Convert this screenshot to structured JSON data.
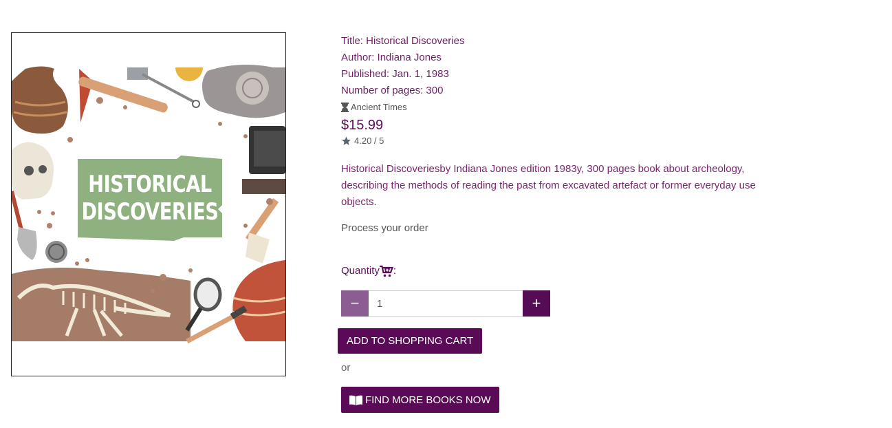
{
  "book": {
    "cover_title_line1": "HISTORICAL",
    "cover_title_line2": "DISCOVERIES",
    "title_line": "Title: Historical Discoveries",
    "author_line": "Author: Indiana Jones",
    "published_line": "Published: Jan. 1, 1983",
    "pages_line": "Number of pages: 300",
    "category": "Ancient Times",
    "category_icon": "hourglass-icon",
    "price": "$15.99",
    "rating_icon": "star-icon",
    "rating": "4.20 / 5",
    "description": "Historical Discoveriesby Indiana Jones edition 1983y, 300 pages book about archeology, describing the methods of reading the past from excavated artefact or former everyday use objects."
  },
  "order": {
    "process_text": "Process your order",
    "quantity_label": "Quantity",
    "quantity_suffix": ":",
    "quantity_value": "1",
    "minus_label": "−",
    "plus_label": "+",
    "add_to_cart_label": "ADD TO SHOPPING CART",
    "or_text": "or",
    "find_more_label": "FIND MORE BOOKS NOW"
  },
  "colors": {
    "primary": "#5a0a56",
    "minus_button": "#8b5d93",
    "cover_banner": "#8fb07f"
  }
}
